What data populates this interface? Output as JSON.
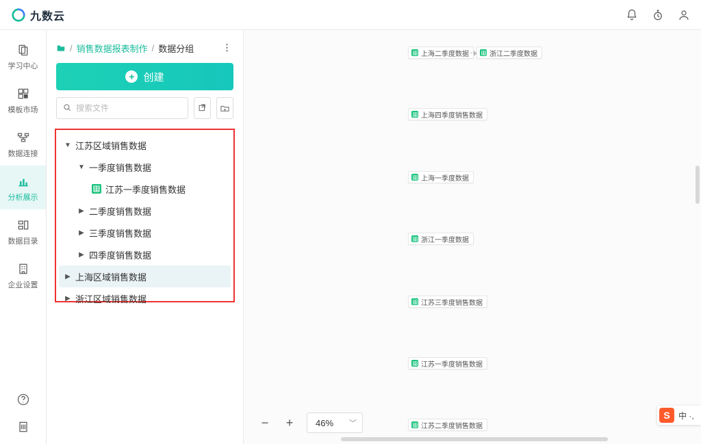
{
  "brand": {
    "name": "九数云"
  },
  "rail": {
    "items": [
      {
        "key": "learn",
        "label": "学习中心"
      },
      {
        "key": "market",
        "label": "模板市场"
      },
      {
        "key": "connect",
        "label": "数据连接"
      },
      {
        "key": "analysis",
        "label": "分析展示"
      },
      {
        "key": "catalog",
        "label": "数据目录"
      },
      {
        "key": "settings",
        "label": "企业设置"
      }
    ]
  },
  "breadcrumb": {
    "root_icon": "folder-icon",
    "sep": "/",
    "link1": "销售数据报表制作",
    "current": "数据分组"
  },
  "create_button": "创建",
  "search": {
    "placeholder": "搜索文件"
  },
  "tree": {
    "n0": {
      "label": "江苏区域销售数据"
    },
    "n1": {
      "label": "一季度销售数据"
    },
    "n1a": {
      "label": "江苏一季度销售数据"
    },
    "n2": {
      "label": "二季度销售数据"
    },
    "n3": {
      "label": "三季度销售数据"
    },
    "n4": {
      "label": "四季度销售数据"
    },
    "n5": {
      "label": "上海区域销售数据"
    },
    "n6": {
      "label": "浙江区域销售数据"
    }
  },
  "zoom": {
    "value": "46%"
  },
  "canvas_nodes": {
    "a": "上海二季度数据",
    "b": "浙江二季度数据",
    "c": "上海四季度销售数据",
    "d": "上海一季度数据",
    "e": "浙江一季度数据",
    "f": "江苏三季度销售数据",
    "g": "江苏一季度销售数据",
    "h": "江苏二季度销售数据"
  },
  "ime": {
    "letter": "S",
    "label": "中 ·,"
  }
}
